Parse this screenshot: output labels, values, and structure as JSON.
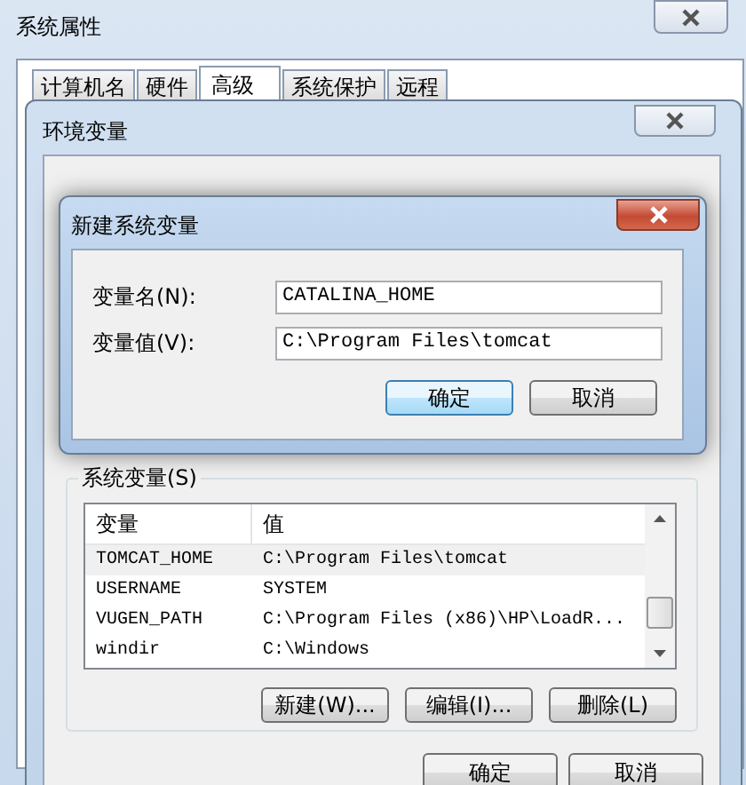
{
  "window": {
    "title": "系统属性"
  },
  "tabs": [
    {
      "label": "计算机名",
      "selected": false
    },
    {
      "label": "硬件",
      "selected": false
    },
    {
      "label": "高级",
      "selected": true
    },
    {
      "label": "系统保护",
      "selected": false
    },
    {
      "label": "远程",
      "selected": false
    }
  ],
  "env_window": {
    "title": "环境变量",
    "system_variables": {
      "label": "系统变量(S)",
      "columns": [
        "变量",
        "值"
      ],
      "rows": [
        {
          "name": "TOMCAT_HOME",
          "value": "C:\\Program Files\\tomcat",
          "selected": true
        },
        {
          "name": "USERNAME",
          "value": "SYSTEM",
          "selected": false
        },
        {
          "name": "VUGEN_PATH",
          "value": "C:\\Program Files (x86)\\HP\\LoadR...",
          "selected": false
        },
        {
          "name": "windir",
          "value": "C:\\Windows",
          "selected": false
        }
      ],
      "buttons": [
        "新建(W)...",
        "编辑(I)...",
        "删除(L)"
      ]
    },
    "buttons": [
      "确定",
      "取消"
    ]
  },
  "dialog": {
    "title": "新建系统变量",
    "fields": [
      {
        "label": "变量名(N):",
        "value": "CATALINA_HOME"
      },
      {
        "label": "变量值(V):",
        "value": "C:\\Program Files\\tomcat"
      }
    ],
    "buttons": [
      {
        "label": "确定",
        "default": true
      },
      {
        "label": "取消",
        "default": false
      }
    ]
  }
}
